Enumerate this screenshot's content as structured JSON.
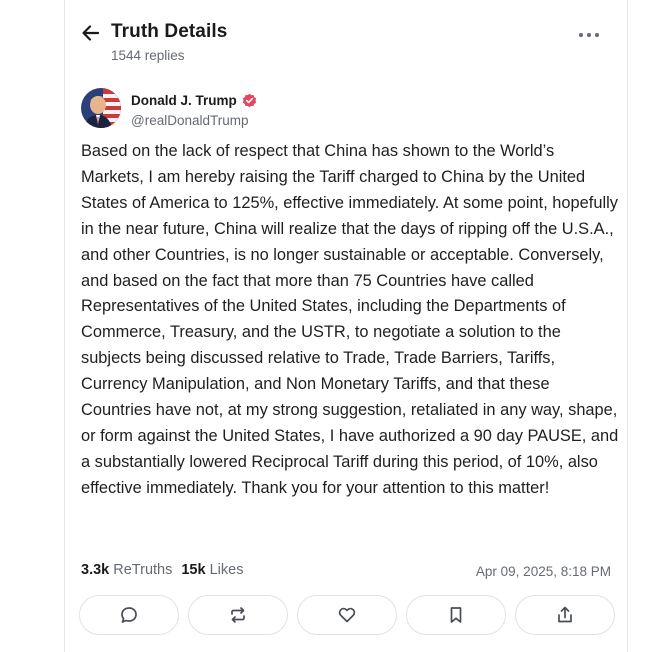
{
  "header": {
    "title": "Truth Details",
    "replies": "1544 replies",
    "back_icon": "arrow-left-icon",
    "more_icon": "more-horizontal-icon"
  },
  "author": {
    "name": "Donald J. Trump",
    "handle": "@realDonaldTrump",
    "verified": true,
    "verified_color": "#e8455f"
  },
  "post": {
    "text": "Based on the lack of respect that China has shown to the World’s Markets, I am hereby raising the Tariff charged to China by the United States of America to 125%, effective immediately. At some point, hopefully in the near future, China will realize that the days of ripping off the U.S.A., and other Countries, is no longer sustainable or acceptable. Conversely, and based on the fact that more than 75 Countries have called Representatives of the United States, including the Departments of Commerce, Treasury, and the USTR, to negotiate a solution to the subjects being discussed relative to Trade, Trade Barriers, Tariffs, Currency Manipulation, and Non Monetary Tariffs, and that these Countries have not, at my strong suggestion, retaliated in any way, shape, or form against the United States, I have authorized a 90 day PAUSE, and a substantially lowered Reciprocal Tariff during this period, of 10%, also effective immediately. Thank you for your attention to this matter!",
    "retruths_count": "3.3k",
    "retruths_label": "ReTruths",
    "likes_count": "15k",
    "likes_label": "Likes",
    "timestamp": "Apr 09, 2025, 8:18 PM"
  },
  "actions": [
    {
      "name": "reply",
      "icon": "comment-icon"
    },
    {
      "name": "retruth",
      "icon": "repost-icon"
    },
    {
      "name": "like",
      "icon": "heart-icon"
    },
    {
      "name": "bookmark",
      "icon": "bookmark-icon"
    },
    {
      "name": "share",
      "icon": "share-icon"
    }
  ]
}
